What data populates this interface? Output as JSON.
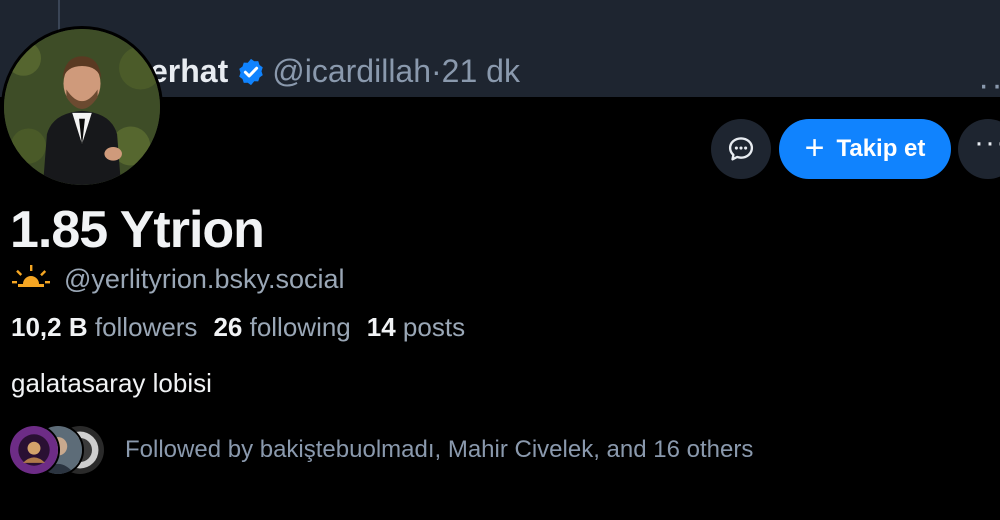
{
  "post": {
    "author_name": "erhat",
    "author_handle": "@icardillah",
    "separator": "·",
    "time_ago": "21 dk",
    "more_glyph": "··"
  },
  "profile": {
    "display_name": "1.85 Ytrion",
    "handle": "@yerlityrion.bsky.social",
    "handle_icon": "sun-icon",
    "bio": "galatasaray lobisi"
  },
  "stats": [
    {
      "count": "10,2 B",
      "label": "followers"
    },
    {
      "count": "26",
      "label": "following"
    },
    {
      "count": "14",
      "label": "posts"
    }
  ],
  "actions": {
    "message_icon": "chat-bubble-icon",
    "follow_label": "Takip et",
    "more_glyph": "···"
  },
  "followed_by": {
    "text": "Followed by bakiştebuolmadı, Mahir Civelek, and 16 others"
  },
  "colors": {
    "accent": "#1083fe",
    "background": "#000000",
    "surface": "#1e2530",
    "muted_text": "#9aa7b6",
    "verified": "#1083fe",
    "sun": "#f5a623"
  }
}
